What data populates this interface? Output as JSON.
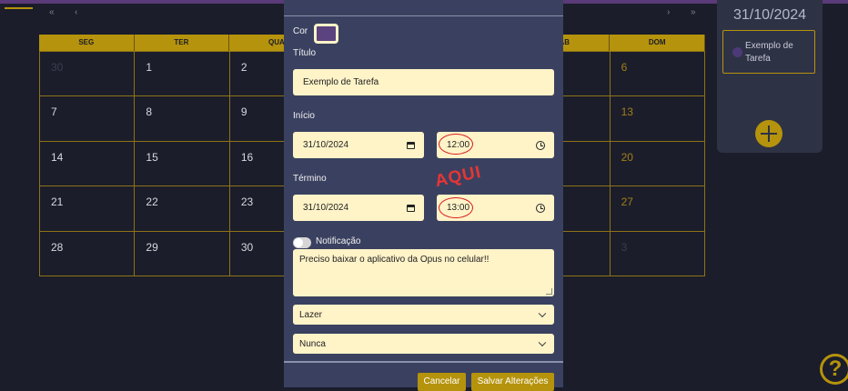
{
  "nav": {
    "prev_year": "«",
    "prev_month": "‹",
    "next_month": "›",
    "next_year": "»"
  },
  "calendar": {
    "weekdays": [
      "SEG",
      "TER",
      "QUA",
      "",
      "",
      "SAB",
      "DOM"
    ],
    "days": [
      [
        "30",
        "1",
        "2",
        "",
        "",
        "",
        "6"
      ],
      [
        "7",
        "8",
        "9",
        "",
        "",
        "",
        "13"
      ],
      [
        "14",
        "15",
        "16",
        "",
        "",
        "",
        "20"
      ],
      [
        "21",
        "22",
        "23",
        "",
        "",
        "",
        "27"
      ],
      [
        "28",
        "29",
        "30",
        "",
        "",
        "",
        "3"
      ]
    ]
  },
  "side_panel": {
    "date": "31/10/2024",
    "event": "Exemplo de Tarefa"
  },
  "modal": {
    "color_label": "Cor",
    "color_value": "#5b437f",
    "title_label": "Título",
    "title_value": "Exemplo de Tarefa",
    "start_label": "Início",
    "start_date": "31/10/2024",
    "start_time": "12:00",
    "end_label": "Término",
    "end_date": "31/10/2024",
    "end_time": "13:00",
    "annotation": "AQUI",
    "notification_label": "Notificação",
    "description": "Preciso baixar o aplicativo da Opus no celular!!",
    "category": "Lazer",
    "repeat": "Nunca",
    "cancel_label": "Cancelar",
    "save_label": "Salvar Alterações"
  },
  "help": {
    "symbol": "?"
  },
  "colors": {
    "accent": "#b5930c",
    "background": "#1b1d2a",
    "modal": "#3a4160",
    "field": "#fff3c8",
    "annotation": "#e73535"
  }
}
